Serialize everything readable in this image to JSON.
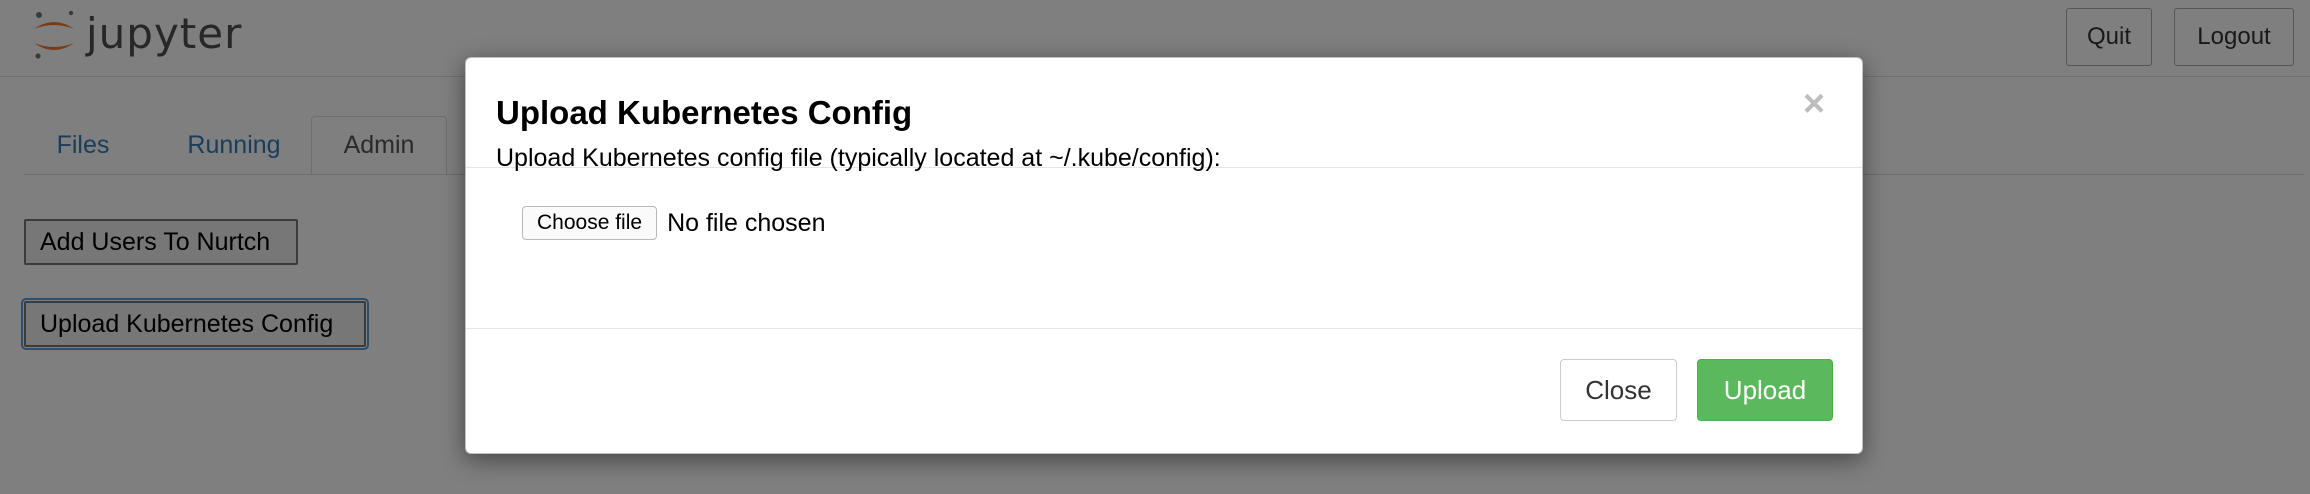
{
  "app": {
    "logo_text": "jupyter",
    "logo_icon": "jupyter-logo-icon"
  },
  "header": {
    "quit_label": "Quit",
    "logout_label": "Logout"
  },
  "tabs": [
    {
      "label": "Files",
      "active": false
    },
    {
      "label": "Running",
      "active": false
    },
    {
      "label": "Admin",
      "active": true
    }
  ],
  "admin": {
    "add_users_label": "Add Users To Nurtch",
    "upload_config_label": "Upload Kubernetes Config"
  },
  "modal": {
    "title": "Upload Kubernetes Config",
    "close_icon": "×",
    "instruction": "Upload Kubernetes config file (typically located at ~/.kube/config):",
    "choose_file_label": "Choose file",
    "no_file_text": "No file chosen",
    "close_label": "Close",
    "upload_label": "Upload"
  },
  "colors": {
    "link": "#337ab7",
    "success": "#5cb85c",
    "logo_orange": "#f37726"
  }
}
